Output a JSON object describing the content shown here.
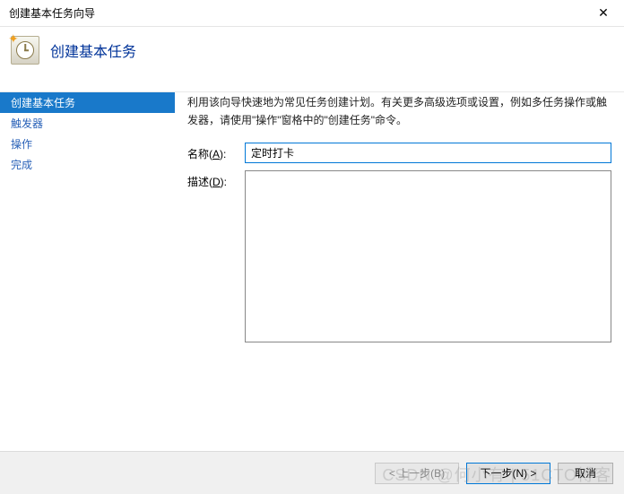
{
  "window": {
    "title": "创建基本任务向导"
  },
  "header": {
    "title": "创建基本任务"
  },
  "sidebar": {
    "items": [
      {
        "label": "创建基本任务",
        "active": true
      },
      {
        "label": "触发器",
        "active": false
      },
      {
        "label": "操作",
        "active": false
      },
      {
        "label": "完成",
        "active": false
      }
    ]
  },
  "content": {
    "intro": "利用该向导快速地为常见任务创建计划。有关更多高级选项或设置，例如多任务操作或触发器，请使用\"操作\"窗格中的\"创建任务\"命令。",
    "name_label_prefix": "名称(",
    "name_label_accel": "A",
    "name_label_suffix": "):",
    "name_value": "定时打卡",
    "desc_label_prefix": "描述(",
    "desc_label_accel": "D",
    "desc_label_suffix": "):",
    "desc_value": ""
  },
  "footer": {
    "back": "< 上一步(B)",
    "next": "下一步(N) >",
    "cancel": "取消"
  },
  "watermark": "CSDN @何小有 | 51CTO博客"
}
